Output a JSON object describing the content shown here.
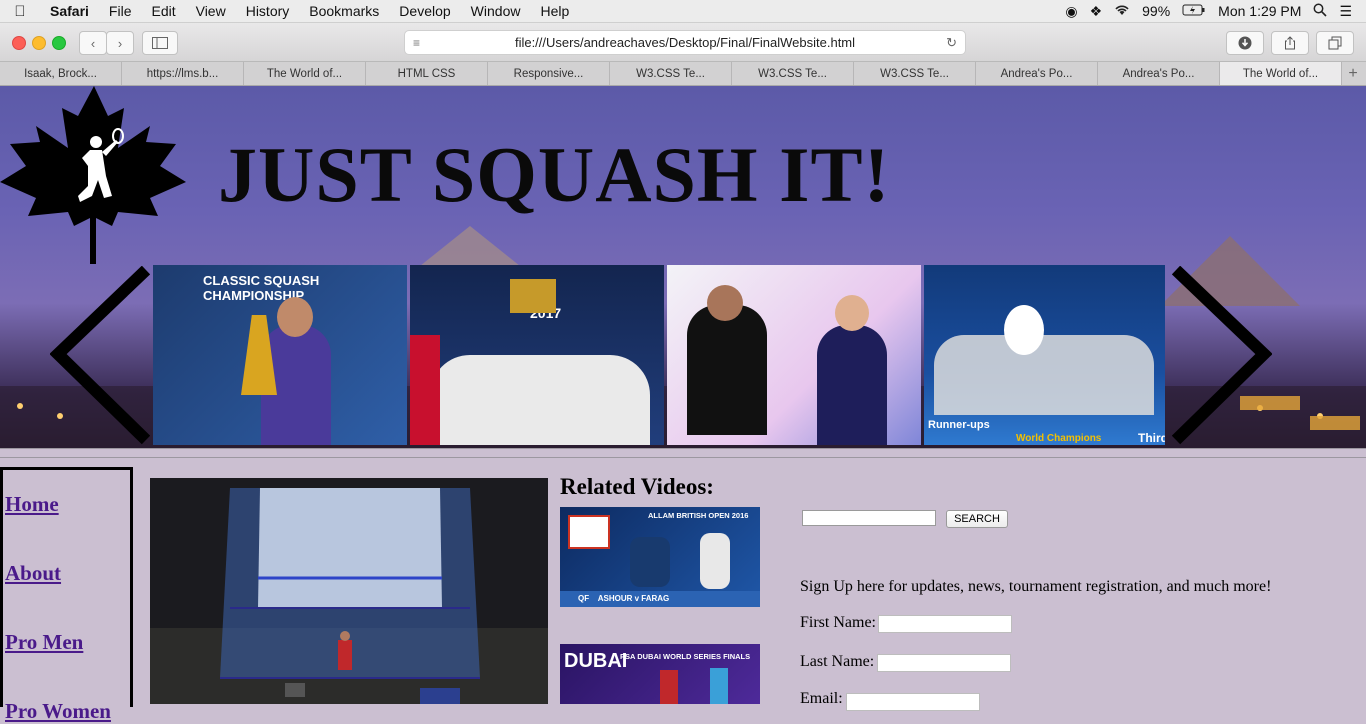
{
  "menubar": {
    "app": "Safari",
    "items": [
      "File",
      "Edit",
      "View",
      "History",
      "Bookmarks",
      "Develop",
      "Window",
      "Help"
    ],
    "battery": "99%",
    "clock": "Mon 1:29 PM"
  },
  "browser": {
    "url": "file:///Users/andreachaves/Desktop/Final/FinalWebsite.html",
    "tabs": [
      "Isaak, Brock...",
      "https://lms.b...",
      "The World of...",
      "HTML CSS",
      "Responsive...",
      "W3.CSS Te...",
      "W3.CSS Te...",
      "W3.CSS Te...",
      "Andrea's Po...",
      "Andrea's Po...",
      "The World of..."
    ],
    "active_tab": 10
  },
  "page": {
    "title": "JUST SQUASH IT!",
    "slides": [
      {
        "caption": "CLASSIC SQUASH CHAMPIONSHIP"
      },
      {
        "caption": "2017"
      },
      {
        "caption": ""
      },
      {
        "caption": "Runner-ups",
        "caption2": "World Champions",
        "caption3": "Third"
      }
    ],
    "nav": [
      "Home",
      "About",
      "Pro Men",
      "Pro Women"
    ],
    "related_title": "Related Videos:",
    "videos": [
      {
        "top": "ALLAM BRITISH OPEN 2016",
        "bottom": "QF    ASHOUR v FARAG"
      },
      {
        "top": "PSA DUBAI WORLD SERIES FINALS",
        "bottom": "DUBAI"
      }
    ],
    "search_button": "SEARCH",
    "signup_text": "Sign Up here for updates, news, tournament registration, and much more!",
    "fields": {
      "first": "First Name:",
      "last": "Last Name:",
      "email": "Email:"
    }
  },
  "colors": {
    "page_bg": "#cbbfd1",
    "link": "#4a1a8a",
    "hero_top": "#5c5aa8"
  }
}
